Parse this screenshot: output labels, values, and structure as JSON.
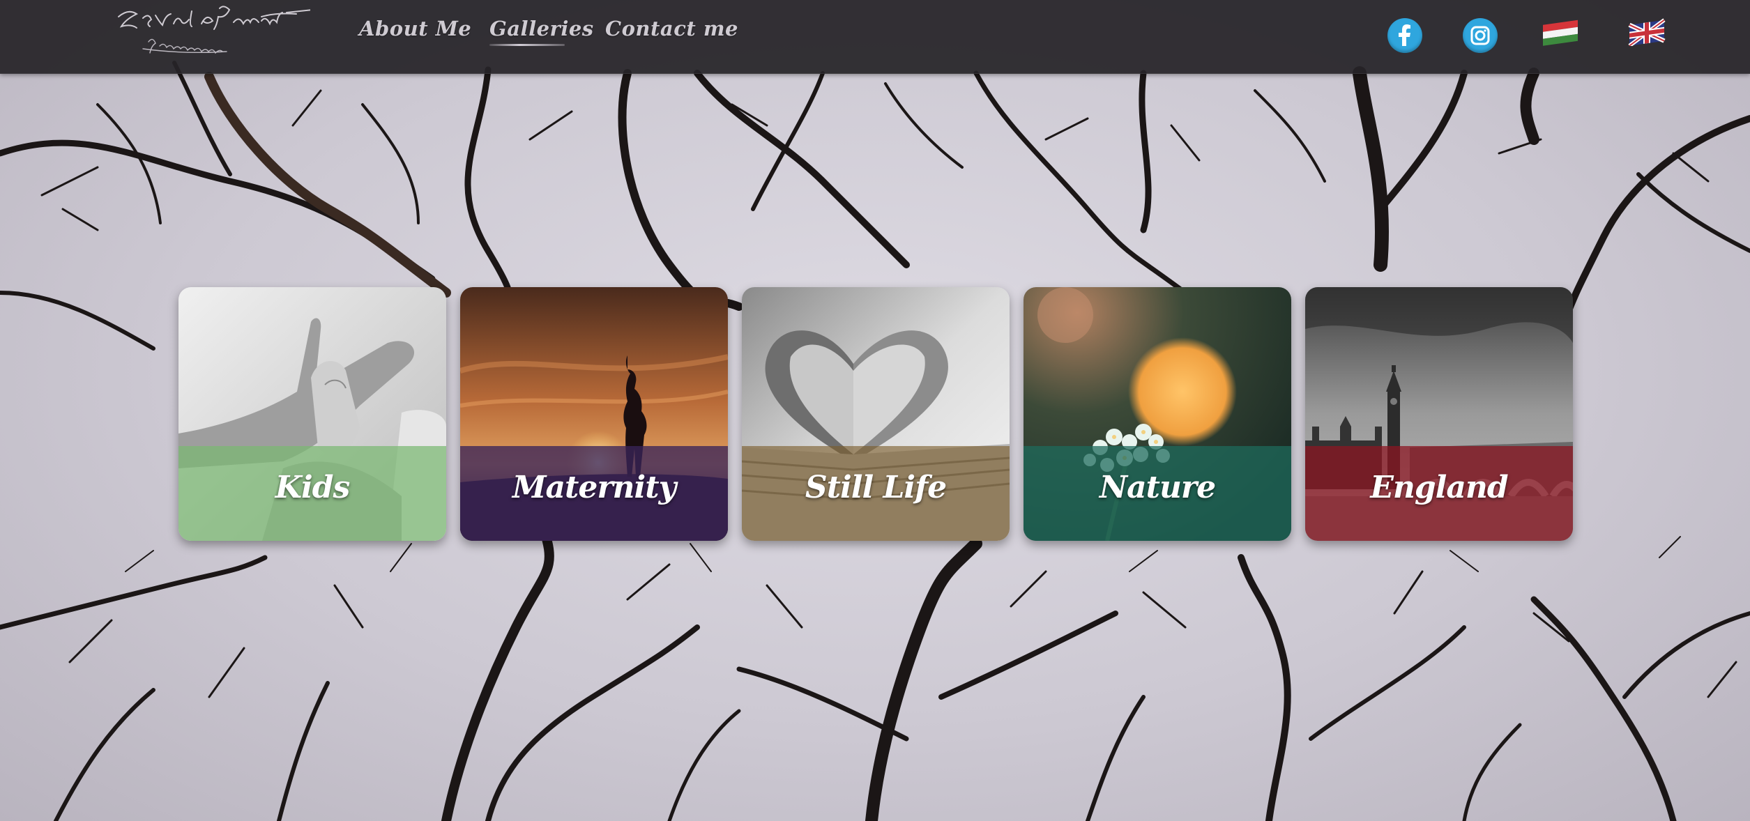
{
  "site": {
    "logo_name": "Zsofia Porzsolt",
    "logo_tagline": "Photography"
  },
  "nav": {
    "items": [
      {
        "label": "About Me"
      },
      {
        "label": "Galleries",
        "active": true
      },
      {
        "label": "Contact me"
      }
    ]
  },
  "social": {
    "icons": [
      "facebook-icon",
      "instagram-icon"
    ],
    "color": "#2fa6de"
  },
  "languages": [
    {
      "icon": "hungarian-flag-icon"
    },
    {
      "icon": "uk-flag-icon"
    }
  ],
  "galleries": [
    {
      "label": "Kids",
      "band_color": "#7ab872"
    },
    {
      "label": "Maternity",
      "band_color": "#3a2458"
    },
    {
      "label": "Still Life",
      "band_color": "#7a5c2a"
    },
    {
      "label": "Nature",
      "band_color": "#1e6a5c"
    },
    {
      "label": "England",
      "band_color": "#8c1522"
    }
  ]
}
